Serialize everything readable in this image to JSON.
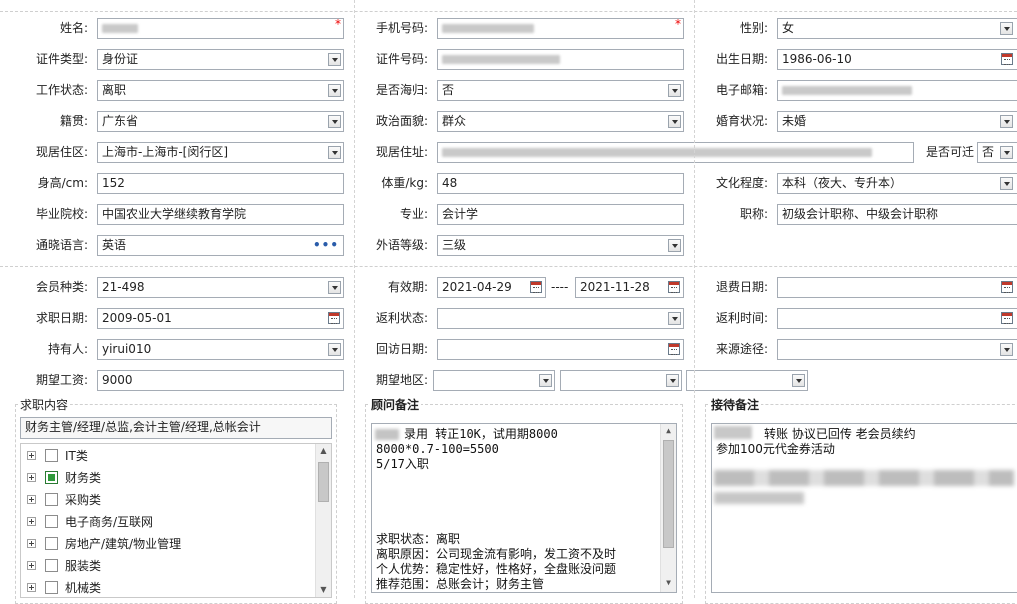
{
  "personal": {
    "name_label": "姓名:",
    "mobile_label": "手机号码:",
    "gender_label": "性别:",
    "gender_value": "女",
    "id_type_label": "证件类型:",
    "id_type_value": "身份证",
    "id_number_label": "证件号码:",
    "birth_label": "出生日期:",
    "birth_value": "1986-06-10",
    "work_status_label": "工作状态:",
    "work_status_value": "离职",
    "returnee_label": "是否海归:",
    "returnee_value": "否",
    "email_label": "电子邮箱:",
    "native_label": "籍贯:",
    "native_value": "广东省",
    "political_label": "政治面貌:",
    "political_value": "群众",
    "marital_label": "婚育状况:",
    "marital_value": "未婚",
    "residence_area_label": "现居住区:",
    "residence_area_value": "上海市-上海市-[闵行区]",
    "address_label": "现居住址:",
    "relocate_label": "是否可迁",
    "relocate_value": "否",
    "height_label": "身高/cm:",
    "height_value": "152",
    "weight_label": "体重/kg:",
    "weight_value": "48",
    "education_label": "文化程度:",
    "education_value": "本科（夜大、专升本）",
    "school_label": "毕业院校:",
    "school_value": "中国农业大学继续教育学院",
    "major_label": "专业:",
    "major_value": "会计学",
    "title_label": "职称:",
    "title_value": "初级会计职称、中级会计职称",
    "language_label": "通晓语言:",
    "language_value": "英语",
    "foreign_level_label": "外语等级:",
    "foreign_level_value": "三级"
  },
  "membership": {
    "member_type_label": "会员种类:",
    "member_type_value": "21-498",
    "valid_label": "有效期:",
    "valid_from": "2021-04-29",
    "valid_sep": "----",
    "valid_to": "2021-11-28",
    "refund_date_label": "退费日期:",
    "job_date_label": "求职日期:",
    "job_date_value": "2009-05-01",
    "rebate_status_label": "返利状态:",
    "rebate_time_label": "返利时间:",
    "holder_label": "持有人:",
    "holder_value": "yirui010",
    "visit_date_label": "回访日期:",
    "source_label": "来源途径:",
    "salary_label": "期望工资:",
    "salary_value": "9000",
    "region_label": "期望地区:"
  },
  "job_content": {
    "title": "求职内容",
    "selected": "财务主管/经理/总监,会计主管/经理,总帐会计",
    "tree": [
      {
        "label": "IT类",
        "checked": false
      },
      {
        "label": "财务类",
        "checked": true
      },
      {
        "label": "采购类",
        "checked": false
      },
      {
        "label": "电子商务/互联网",
        "checked": false
      },
      {
        "label": "房地产/建筑/物业管理",
        "checked": false
      },
      {
        "label": "服装类",
        "checked": false
      },
      {
        "label": "机械类",
        "checked": false
      }
    ]
  },
  "advisor_notes": {
    "title": "顾问备注",
    "lines": [
      "录用 转正10K，试用期8000",
      "8000*0.7-100=5500",
      "5/17入职",
      "",
      "",
      "",
      "",
      "求职状态：离职",
      "离职原因：公司现金流有影响，发工资不及时",
      "个人优势：稳定性好，性格好，全盘账没问题",
      "推荐范围：总账会计；财务主管"
    ]
  },
  "reception_notes": {
    "title": "接待备注",
    "lines": [
      "转账 协议已回传 老会员续约",
      "参加100元代金券活动"
    ]
  },
  "icons": {
    "dropdown": "chevron-down-icon",
    "calendar": "calendar-icon",
    "more": "ellipsis-icon",
    "expand": "plus-icon",
    "required": "asterisk-icon"
  }
}
